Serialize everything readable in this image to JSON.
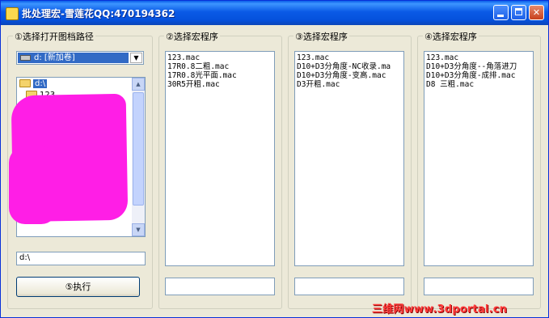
{
  "window": {
    "title": "批处理宏-雪莲花QQ:470194362"
  },
  "groups": [
    {
      "label": "①选择打开图档路径"
    },
    {
      "label": "②选择宏程序"
    },
    {
      "label": "③选择宏程序"
    },
    {
      "label": "④选择宏程序"
    }
  ],
  "drive_combo": {
    "value": "d: [新加卷]"
  },
  "tree": {
    "items": [
      "d:\\",
      "123"
    ]
  },
  "path_field": {
    "value": "d:\\"
  },
  "execute_button": {
    "label": "⑤执行"
  },
  "list2": {
    "items": [
      "123.mac",
      "17R0.8二粗.mac",
      "17R0.8光平面.mac",
      "30R5开粗.mac"
    ]
  },
  "list3": {
    "items": [
      "123.mac",
      "D10+D3分角度-NC收录.ma",
      "D10+D3分角度-变高.mac",
      "D3开粗.mac"
    ]
  },
  "list4": {
    "items": [
      "123.mac",
      "D10+D3分角度--角落进刀",
      "D10+D3分角度-成排.mac",
      "D8 三粗.mac"
    ]
  },
  "watermark": {
    "text": "三维网www.3dportal.cn"
  }
}
